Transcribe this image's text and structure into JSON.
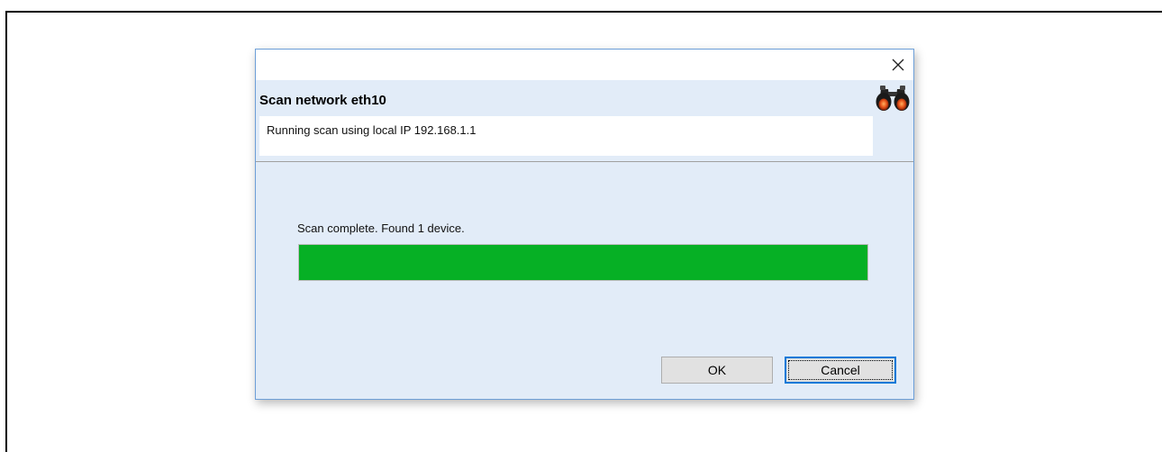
{
  "dialog": {
    "close_glyph": "✕",
    "heading": "Scan network eth10",
    "subtitle": "Running scan using local IP 192.168.1.1",
    "icon": "binoculars-icon"
  },
  "scan": {
    "status": "Scan complete. Found 1 device.",
    "progress_percent": 100,
    "progress_color": "#06b025"
  },
  "buttons": {
    "ok_label": "OK",
    "cancel_label": "Cancel"
  }
}
